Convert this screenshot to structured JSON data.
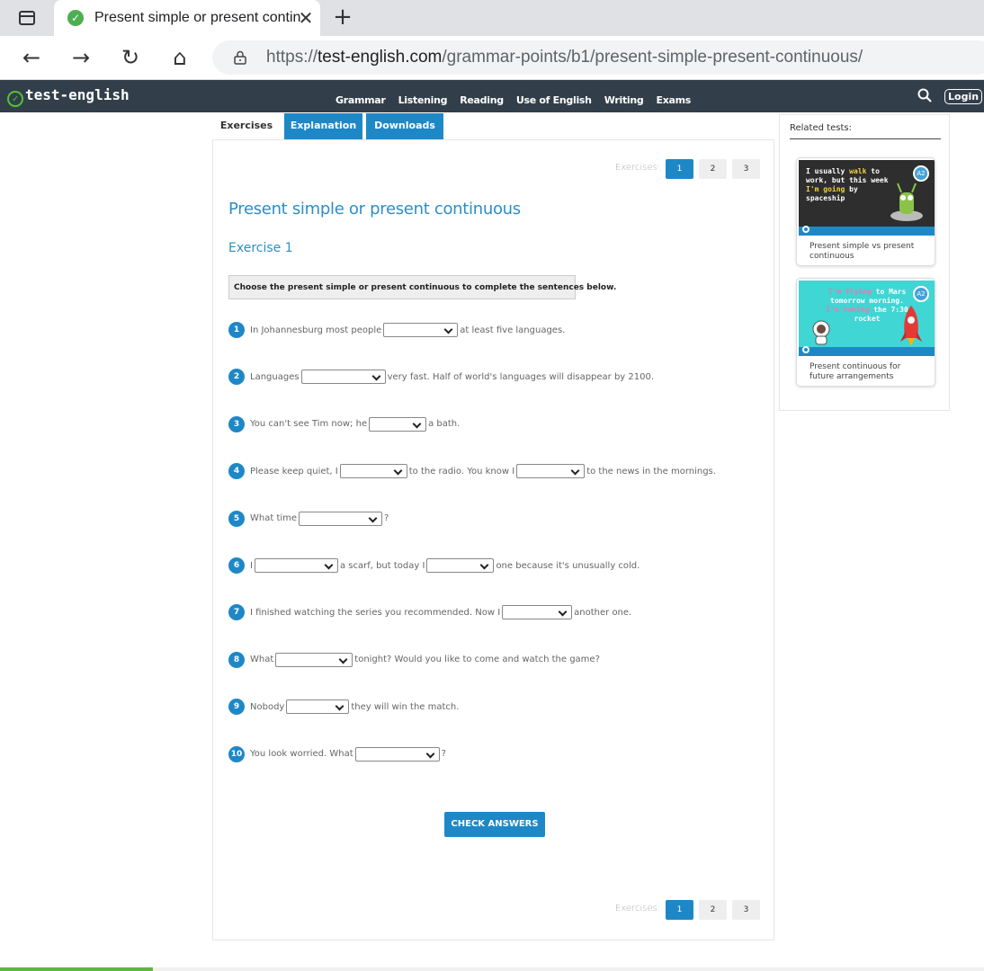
{
  "browser": {
    "tab_title": "Present simple or present continuous | Test-English",
    "url_scheme": "https://",
    "url_host": "test-english.com",
    "url_path": "/grammar-points/b1/present-simple-present-continuous/"
  },
  "site": {
    "logo": "test-english",
    "nav": [
      "Grammar",
      "Listening",
      "Reading",
      "Use of English",
      "Writing",
      "Exams"
    ],
    "login": "Login"
  },
  "tabs": {
    "exercises": "Exercises",
    "explanation": "Explanation",
    "downloads": "Downloads"
  },
  "pager": {
    "label": "Exercises:",
    "pages": [
      "1",
      "2",
      "3"
    ],
    "active": "1"
  },
  "main": {
    "title": "Present simple or present continuous",
    "exercise_heading": "Exercise 1",
    "instruction": "Choose the present simple or present continuous to complete the sentences below."
  },
  "questions": [
    {
      "num": "1",
      "parts": [
        "In Johannesburg most people",
        "at least five languages."
      ]
    },
    {
      "num": "2",
      "parts": [
        "Languages",
        "very fast. Half of world's languages will disappear by 2100."
      ]
    },
    {
      "num": "3",
      "parts": [
        "You can't see Tim now; he",
        "a bath."
      ]
    },
    {
      "num": "4",
      "parts": [
        "Please keep quiet, I",
        "to the radio. You know I",
        "to the news in the mornings."
      ]
    },
    {
      "num": "5",
      "parts": [
        "What time",
        "?"
      ]
    },
    {
      "num": "6",
      "parts": [
        "I",
        "a scarf, but today I",
        "one because it's unusually cold."
      ]
    },
    {
      "num": "7",
      "parts": [
        "I finished watching the series you recommended. Now I",
        "another one."
      ]
    },
    {
      "num": "8",
      "parts": [
        "What",
        "tonight? Would you like to come and watch the game?"
      ]
    },
    {
      "num": "9",
      "parts": [
        "Nobody",
        "they will win the match."
      ]
    },
    {
      "num": "10",
      "parts": [
        "You look worried. What",
        "?"
      ]
    }
  ],
  "check_button": "CHECK ANSWERS",
  "related": {
    "title": "Related tests:",
    "cards": [
      {
        "thumb_text_1": "I usually ",
        "thumb_hl_1": "walk",
        "thumb_text_2": " to work, but this week ",
        "thumb_hl_2": "I'm going",
        "thumb_text_3": " by spaceship",
        "badge": "A2",
        "caption": "Present simple vs present continuous"
      },
      {
        "thumb_text_1": "",
        "thumb_hl_1": "I'm flying",
        "thumb_text_2": " to Mars tomorrow morning. ",
        "thumb_hl_2": "I'm taking",
        "thumb_text_3": " the 7:30 rocket",
        "badge": "A2",
        "caption": "Present continuous for future arrangements"
      }
    ]
  },
  "colors": {
    "accent": "#1e88c7",
    "navbar": "#323f4b",
    "title": "#2d8ec5"
  }
}
